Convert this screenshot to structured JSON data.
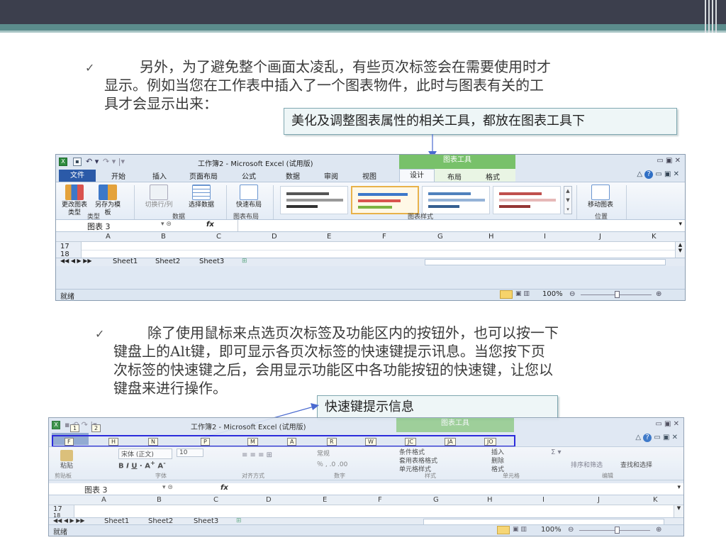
{
  "slide": {
    "para1": "另外，为了避免整个画面太凌乱，有些页次标签会在需要使用时才显示。例如当您在工作表中插入了一个图表物件，此时与图表有关的工具才会显示出来：",
    "para1_lines": [
      "另外，为了避免整个画面太凌乱，有些页次标签会在需要使用时才",
      "显示。例如当您在工作表中插入了一个图表物件，此时与图表有关的工",
      "具才会显示出来："
    ],
    "callout1": "美化及调整图表属性的相关工具，都放在图表工具下",
    "para2_lines": [
      "除了使用鼠标来点选页次标签及功能区内的按钮外，也可以按一下",
      "键盘上的Alt键，即可显示各页次标签的快速键提示讯息。当您按下页",
      "次标签的快速键之后，会用显示功能区中各功能按钮的快速键，让您以",
      "键盘来进行操作。"
    ],
    "callout2": "快速键提示信息",
    "check_icon": "✓"
  },
  "excel1": {
    "title": "工作簿2 - Microsoft Excel (试用版)",
    "context_header": "图表工具",
    "tabs": [
      "文件",
      "开始",
      "插入",
      "页面布局",
      "公式",
      "数据",
      "审阅",
      "视图"
    ],
    "context_tabs": [
      "设计",
      "布局",
      "格式"
    ],
    "buttons": {
      "change_type": "更改图表类型",
      "save_template": "另存为模板",
      "switch_rowcol": "切换行/列",
      "select_data": "选择数据",
      "quick_layout": "快速布局",
      "move_chart": "移动图表"
    },
    "groups": [
      "类型",
      "数据",
      "图表布局",
      "图表样式",
      "位置"
    ],
    "namebox": "图表 3",
    "fx": "fx",
    "columns": [
      "A",
      "B",
      "C",
      "D",
      "E",
      "F",
      "G",
      "H",
      "I",
      "J",
      "K"
    ],
    "rows": [
      "17",
      "18"
    ],
    "sheets": [
      "Sheet1",
      "Sheet2",
      "Sheet3"
    ],
    "status": "就绪",
    "zoom": "100%"
  },
  "excel2": {
    "title": "工作簿2 - Microsoft Excel (试用版)",
    "context_header": "图表工具",
    "keytips": [
      "F",
      "H",
      "N",
      "P",
      "M",
      "A",
      "R",
      "W",
      "JC",
      "JA",
      "JO"
    ],
    "badge_qa": "1",
    "badge_qb": "2",
    "ribbon_items": {
      "paste": "粘贴",
      "font": "宋体 (正文)",
      "font_size": "10",
      "font_label": "字体",
      "align_label": "对齐方式",
      "number_fmt": "常规",
      "number_label": "数字",
      "cond_fmt": "条件格式",
      "table_fmt": "套用表格格式",
      "cell_style": "单元格样式",
      "style_label": "样式",
      "insert": "插入",
      "delete": "删除",
      "format": "格式",
      "cells_label": "单元格",
      "sort": "排序和筛选",
      "find": "查找和选择",
      "edit_label": "编辑",
      "clipboard_label": "剪贴板"
    },
    "namebox": "图表 3",
    "fx": "fx",
    "rows": [
      "17",
      "18"
    ],
    "sheets": [
      "Sheet1",
      "Sheet2",
      "Sheet3"
    ],
    "status": "就绪",
    "zoom": "100%"
  },
  "colors": {
    "accent": "#5b8c8c",
    "topbar": "#3c3f4d",
    "chart_tools": "#78c16a",
    "file_tab": "#2b5aa8",
    "keytip_box": "#1a1ad8"
  }
}
